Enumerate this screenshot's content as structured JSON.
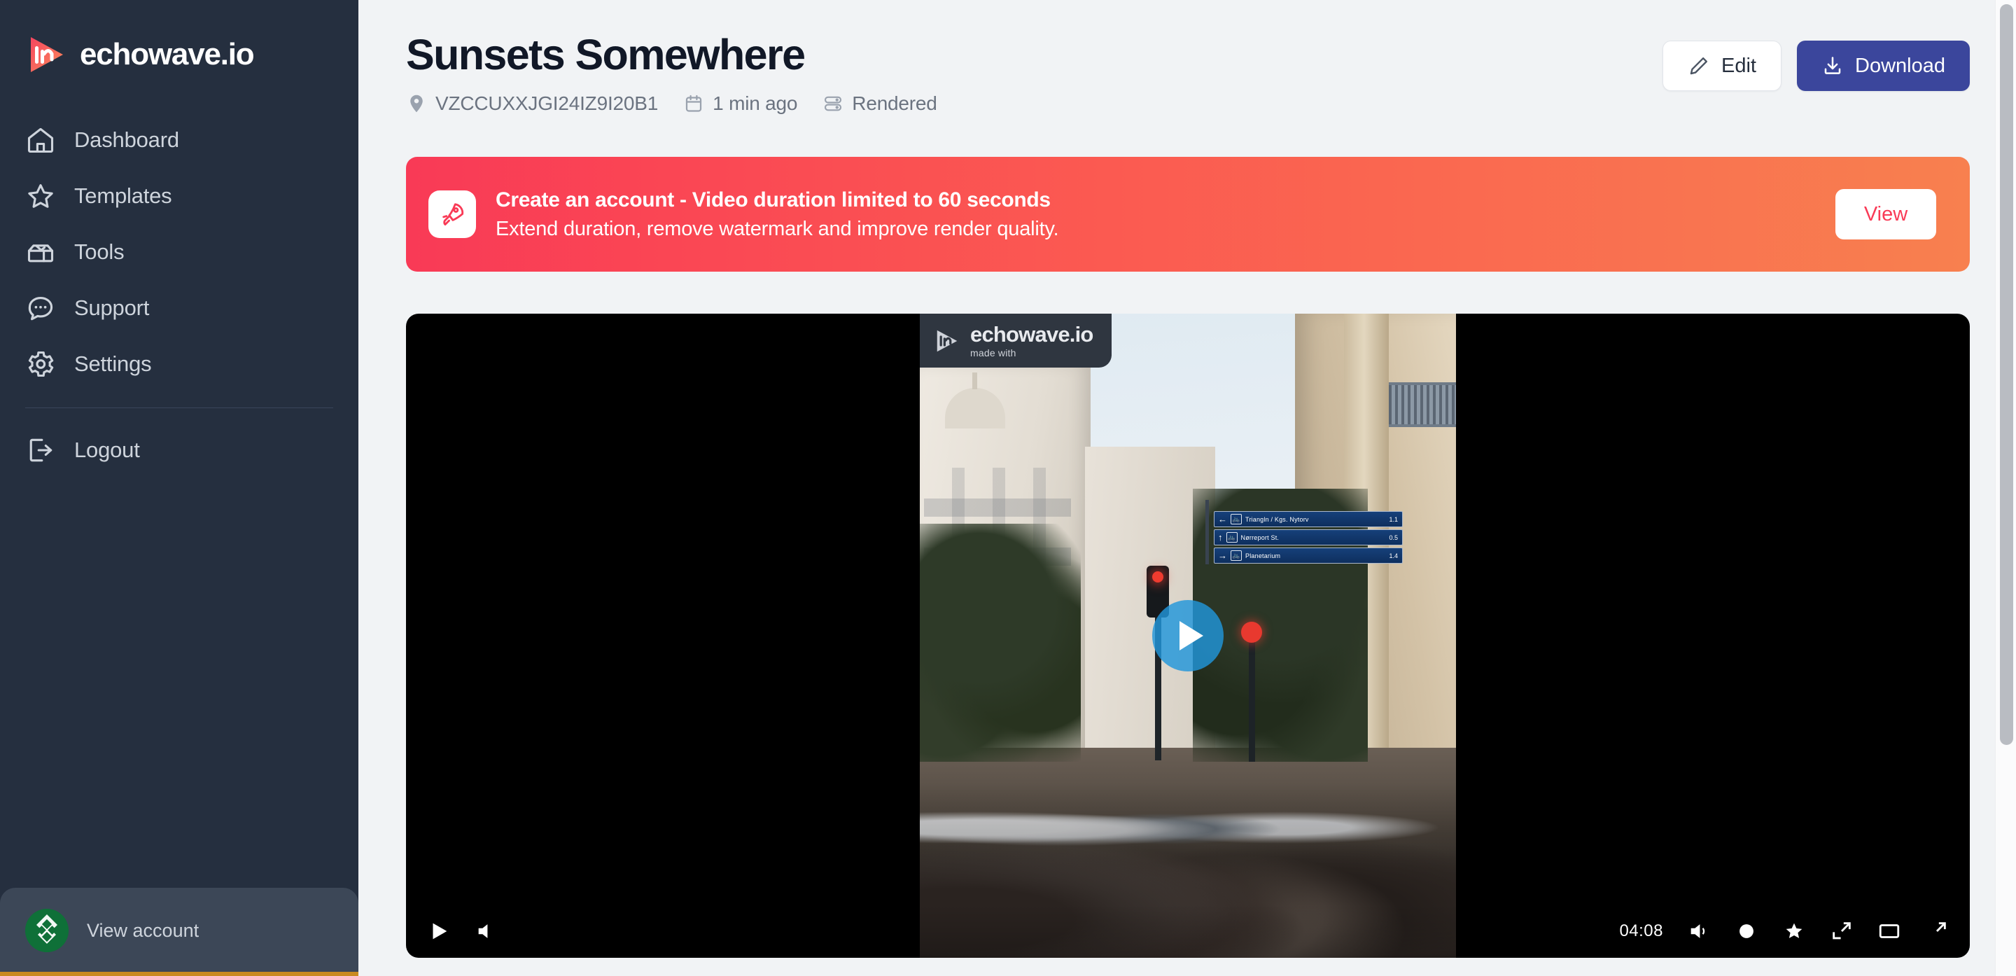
{
  "brand": {
    "name": "echowave.io",
    "logo_icon": "echowave-play-logo"
  },
  "sidebar": {
    "items": [
      {
        "label": "Dashboard",
        "icon": "home-icon"
      },
      {
        "label": "Templates",
        "icon": "star-icon"
      },
      {
        "label": "Tools",
        "icon": "toolbox-icon"
      },
      {
        "label": "Support",
        "icon": "chat-bubble-icon"
      },
      {
        "label": "Settings",
        "icon": "gear-icon"
      }
    ],
    "logout": {
      "label": "Logout",
      "icon": "logout-icon"
    },
    "account": {
      "label": "View account",
      "avatar_icon": "user-avatar"
    }
  },
  "header": {
    "title": "Sunsets Somewhere",
    "meta": [
      {
        "icon": "location-pin-icon",
        "text": "VZCCUXXJGI24IZ9I20B1"
      },
      {
        "icon": "calendar-icon",
        "text": "1 min ago"
      },
      {
        "icon": "server-icon",
        "text": "Rendered"
      }
    ],
    "actions": {
      "edit": {
        "label": "Edit",
        "icon": "pencil-icon"
      },
      "download": {
        "label": "Download",
        "icon": "download-icon",
        "color": "#3b469c"
      }
    }
  },
  "banner": {
    "icon": "rocket-icon",
    "title": "Create an account - Video duration limited to 60 seconds",
    "subtitle": "Extend duration, remove watermark and improve render quality.",
    "button_label": "View",
    "gradient_from": "#f93a56",
    "gradient_to": "#f8804f",
    "button_text_color": "#f93a56"
  },
  "video": {
    "watermark": {
      "name": "echowave.io",
      "sub": "made with",
      "icon": "echowave-play-logo"
    },
    "play_button": {
      "icon": "play-icon",
      "color": "#2196da"
    },
    "controls": {
      "play": "play-icon",
      "volume": "volume-icon",
      "time": "04:08",
      "mute": "speaker-icon",
      "settings": "cog-icon",
      "quality": "sparkle-icon",
      "pip": "picture-in-picture-icon",
      "theater": "theater-mode-icon",
      "fullscreen": "fullscreen-icon"
    },
    "scene": {
      "signs": [
        {
          "arrow": "left",
          "lines": "Triangln / Kgs. Nytorv",
          "distance": "1.1"
        },
        {
          "arrow": "up",
          "lines": "Nørreport St.",
          "distance": "0.5"
        },
        {
          "arrow": "right",
          "lines": "Planetarium",
          "distance": "1.4"
        }
      ]
    }
  },
  "scrollbar": {
    "visible": true
  }
}
